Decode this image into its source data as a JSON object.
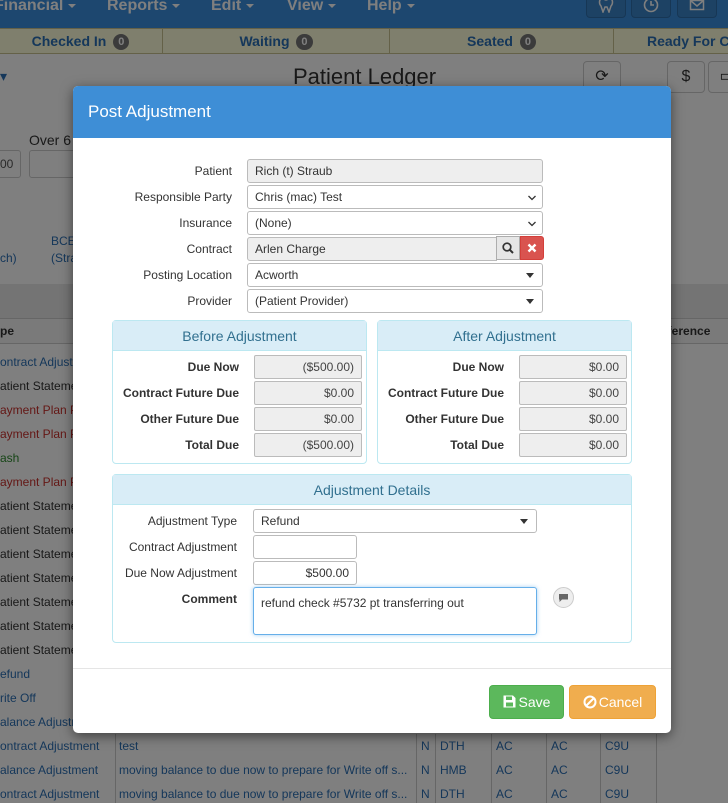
{
  "navbar": {
    "menus": [
      "Financial",
      "Reports",
      "Edit",
      "View",
      "Help"
    ]
  },
  "statusbar": [
    {
      "label": "Checked In",
      "count": "0"
    },
    {
      "label": "Waiting",
      "count": "0"
    },
    {
      "label": "Seated",
      "count": "0"
    },
    {
      "label": "Ready For C"
    }
  ],
  "background": {
    "page_title": "Patient Ledger",
    "over_label": "Over 6",
    "input_value": "00",
    "link_bcb": "BCE",
    "link_stra": "(Stra",
    "link_ch": "ch)",
    "col_type": "pe",
    "col_reference": "eference",
    "dollar": "$",
    "rows": [
      {
        "type": "ontract Adjustm",
        "color": "#2a6fb5"
      },
      {
        "type": "atient Statemen",
        "color": "#333333"
      },
      {
        "type": "ayment Plan P",
        "color": "#c9302c"
      },
      {
        "type": "ayment Plan P",
        "color": "#c9302c"
      },
      {
        "type": "ash",
        "color": "#2e8b2e"
      },
      {
        "type": "ayment Plan P",
        "color": "#c9302c"
      },
      {
        "type": "atient Stateme",
        "color": "#333333"
      },
      {
        "type": "atient Stateme",
        "color": "#333333"
      },
      {
        "type": "atient Stateme",
        "color": "#333333"
      },
      {
        "type": "atient Stateme",
        "color": "#333333"
      },
      {
        "type": "atient Stateme",
        "color": "#333333"
      },
      {
        "type": "atient Stateme",
        "color": "#333333"
      },
      {
        "type": "atient Stateme",
        "color": "#333333"
      },
      {
        "type": "efund",
        "color": "#2a6fb5"
      },
      {
        "type": "rite Off",
        "color": "#2a6fb5"
      },
      {
        "type": "alance Adjustm",
        "color": "#2a6fb5"
      },
      {
        "type": "ontract Adjustment",
        "color": "#2a6fb5",
        "desc": "test",
        "n": "N",
        "c3": "DTH",
        "c4": "AC",
        "c5": "AC",
        "c6": "C9U"
      },
      {
        "type": "alance Adjustment",
        "color": "#2a6fb5",
        "desc": "moving balance to due now to prepare for Write off s...",
        "n": "N",
        "c3": "HMB",
        "c4": "AC",
        "c5": "AC",
        "c6": "C9U"
      },
      {
        "type": "ontract Adjustment",
        "color": "#2a6fb5",
        "desc": "moving balance to due now to prepare for Write off s...",
        "n": "N",
        "c3": "DTH",
        "c4": "AC",
        "c5": "AC",
        "c6": "C9U"
      }
    ]
  },
  "modal": {
    "title": "Post Adjustment",
    "fields": {
      "patient_label": "Patient",
      "patient_value": "Rich (t) Straub",
      "responsible_label": "Responsible Party",
      "responsible_value": "Chris (mac) Test",
      "insurance_label": "Insurance",
      "insurance_value": "(None)",
      "contract_label": "Contract",
      "contract_value": "Arlen Charge",
      "location_label": "Posting Location",
      "location_value": "Acworth",
      "provider_label": "Provider",
      "provider_value": "(Patient Provider)"
    },
    "before": {
      "title": "Before Adjustment",
      "rows": [
        {
          "label": "Due Now",
          "value": "($500.00)"
        },
        {
          "label": "Contract Future Due",
          "value": "$0.00"
        },
        {
          "label": "Other Future Due",
          "value": "$0.00"
        },
        {
          "label": "Total Due",
          "value": "($500.00)"
        }
      ]
    },
    "after": {
      "title": "After Adjustment",
      "rows": [
        {
          "label": "Due Now",
          "value": "$0.00"
        },
        {
          "label": "Contract Future Due",
          "value": "$0.00"
        },
        {
          "label": "Other Future Due",
          "value": "$0.00"
        },
        {
          "label": "Total Due",
          "value": "$0.00"
        }
      ]
    },
    "details": {
      "title": "Adjustment Details",
      "type_label": "Adjustment Type",
      "type_value": "Refund",
      "contract_adj_label": "Contract Adjustment",
      "contract_adj_value": "",
      "due_now_adj_label": "Due Now Adjustment",
      "due_now_adj_value": "$500.00",
      "comment_label": "Comment",
      "comment_value": "refund check #5732 pt transferring out"
    },
    "buttons": {
      "save": "Save",
      "cancel": "Cancel"
    }
  }
}
